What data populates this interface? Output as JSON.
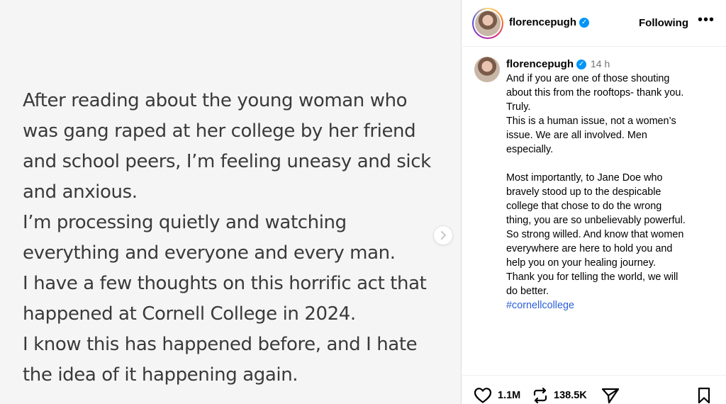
{
  "slide": {
    "lines": [
      "After reading about the young woman who",
      "was gang raped at her college by her friend",
      "and school peers, I’m feeling uneasy and sick",
      "and anxious.",
      "I’m processing quietly and watching",
      "everything and everyone and every man.",
      "I have a few thoughts on this horrific act that",
      "happened at Cornell College in 2024.",
      "I know this has happened before, and I hate",
      "the idea of it happening again."
    ]
  },
  "header": {
    "username": "florencepugh",
    "following_label": "Following",
    "more_glyph": "•••"
  },
  "caption": {
    "username": "florencepugh",
    "time": "14 h",
    "lines": [
      "And if you are one of those shouting",
      "about this from the rooftops- thank you.",
      "Truly.",
      "This is a human issue, not a women’s",
      "issue. We are all involved. Men",
      "especially.",
      "",
      "Most importantly, to Jane Doe who",
      "bravely stood up to the despicable",
      "college that chose to do the wrong",
      "thing, you are so unbelievably powerful.",
      "So strong willed. And know that women",
      "everywhere are here to hold you and",
      "help you on your healing journey.",
      "Thank you for telling the world, we will",
      "do better."
    ],
    "hashtag": "#cornellcollege"
  },
  "actions": {
    "likes": "1.1M",
    "reposts": "138.5K"
  },
  "icons": {
    "next": "chevron-right-icon",
    "verified": "verified-badge-icon",
    "more": "more-icon",
    "like": "heart-icon",
    "repost": "repost-icon",
    "share": "share-icon",
    "save": "bookmark-icon"
  },
  "colors": {
    "verified": "#0095f6",
    "hashtag": "#2b5fd9",
    "media_bg": "#f5f5f5"
  }
}
